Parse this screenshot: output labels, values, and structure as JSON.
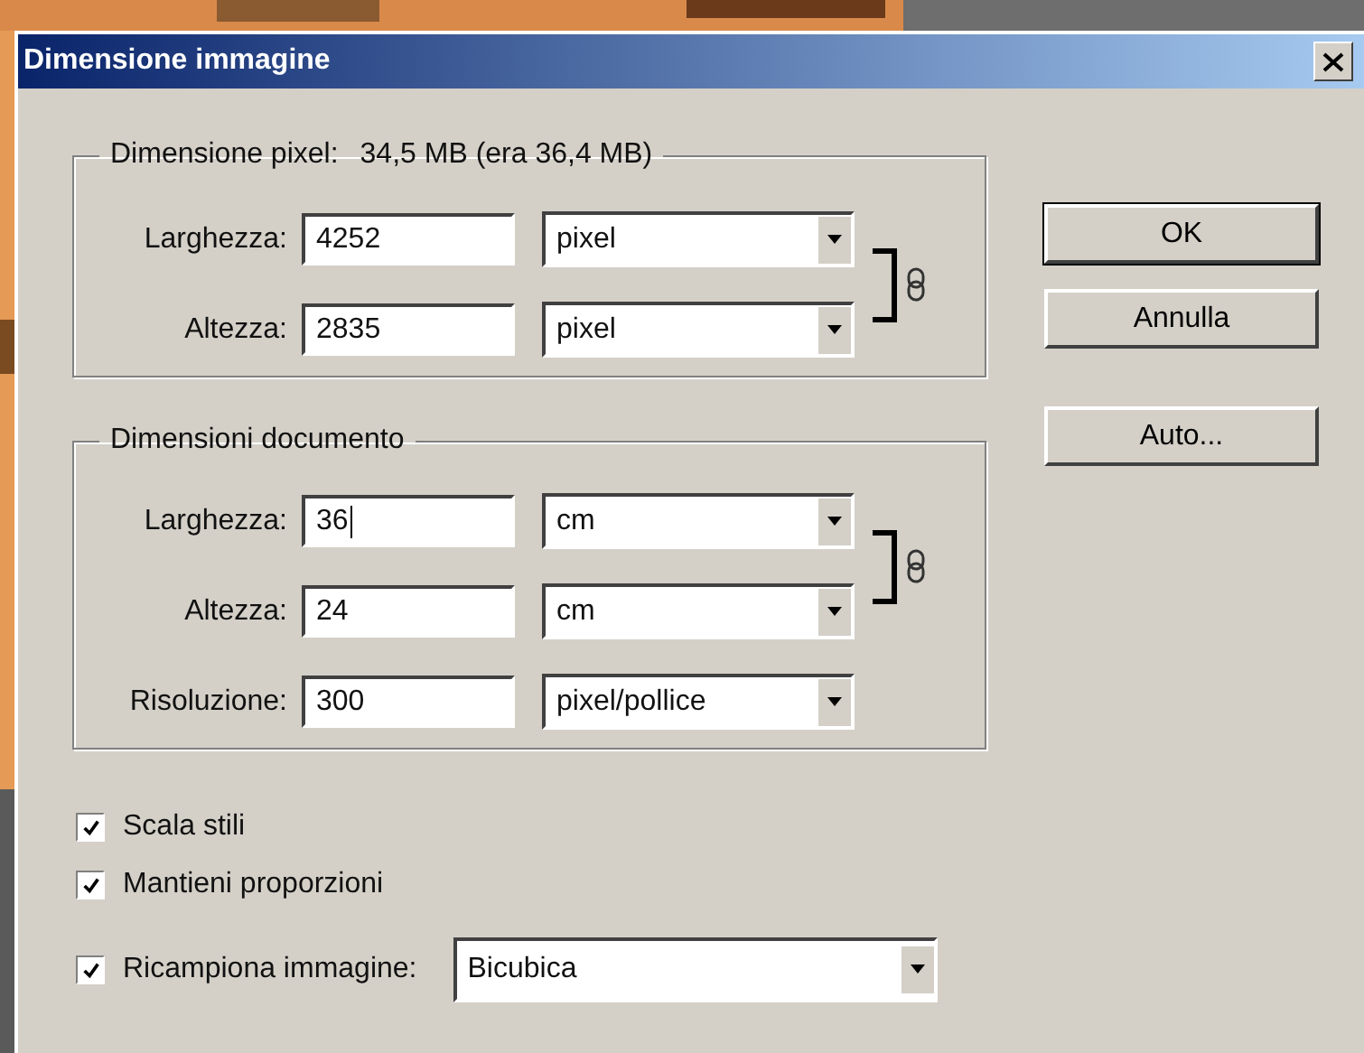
{
  "window": {
    "title": "Dimensione immagine"
  },
  "pixel_dimensions": {
    "legend": "Dimensione pixel:",
    "size": "34,5 MB (era 36,4 MB)",
    "rows": [
      {
        "label": "Larghezza:",
        "value": "4252",
        "unit": "pixel",
        "focused": false
      },
      {
        "label": "Altezza:",
        "value": "2835",
        "unit": "pixel",
        "focused": false
      }
    ]
  },
  "document_size": {
    "legend": "Dimensioni documento",
    "rows": [
      {
        "label": "Larghezza:",
        "value": "36",
        "unit": "cm",
        "focused": true
      },
      {
        "label": "Altezza:",
        "value": "24",
        "unit": "cm",
        "focused": false
      },
      {
        "label": "Risoluzione:",
        "value": "300",
        "unit": "pixel/pollice",
        "focused": false
      }
    ]
  },
  "options": [
    {
      "label": "Scala stili",
      "checked": true
    },
    {
      "label": "Mantieni proporzioni",
      "checked": true
    }
  ],
  "resample": {
    "label": "Ricampiona immagine:",
    "checked": true,
    "method": "Bicubica"
  },
  "buttons": [
    {
      "label": "OK",
      "default": true
    },
    {
      "label": "Annulla",
      "default": false
    },
    {
      "label": "Auto...",
      "default": false
    }
  ]
}
